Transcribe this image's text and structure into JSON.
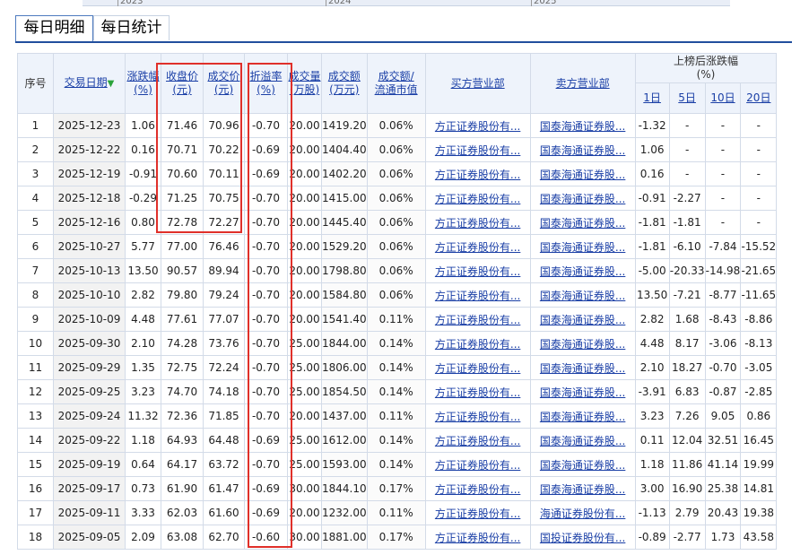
{
  "year_axis": [
    "2023",
    "2024",
    "2025"
  ],
  "tabs": [
    {
      "label": "每日明细",
      "active": true
    },
    {
      "label": "每日统计",
      "active": false
    }
  ],
  "headers": {
    "seq": "序号",
    "date": "交易日期",
    "change": [
      "涨跌幅",
      "(%)"
    ],
    "close": [
      "收盘价",
      "(元)"
    ],
    "deal_price": [
      "成交价",
      "(元)"
    ],
    "premium": [
      "折溢率",
      "(%)"
    ],
    "volume": [
      "成交量",
      "(万股)"
    ],
    "amount": [
      "成交额",
      "(万元)"
    ],
    "ratio": [
      "成交额/",
      "流通市值"
    ],
    "buyer": "买方营业部",
    "seller": "卖方营业部",
    "after": [
      "上榜后涨跌幅",
      "(%)"
    ],
    "after_days": [
      "1日",
      "5日",
      "10日",
      "20日"
    ]
  },
  "rows": [
    {
      "seq": "1",
      "date": "2025-12-23",
      "change": "1.06",
      "close": "71.46",
      "price": "70.96",
      "premium": "-0.70",
      "volume": "20.00",
      "amount": "1419.20",
      "ratio": "0.06%",
      "buyer": "方正证券股份有...",
      "seller": "国泰海通证券股...",
      "d1": "-1.32",
      "d5": "-",
      "d10": "-",
      "d20": "-"
    },
    {
      "seq": "2",
      "date": "2025-12-22",
      "change": "0.16",
      "close": "70.71",
      "price": "70.22",
      "premium": "-0.69",
      "volume": "20.00",
      "amount": "1404.40",
      "ratio": "0.06%",
      "buyer": "方正证券股份有...",
      "seller": "国泰海通证券股...",
      "d1": "1.06",
      "d5": "-",
      "d10": "-",
      "d20": "-"
    },
    {
      "seq": "3",
      "date": "2025-12-19",
      "change": "-0.91",
      "close": "70.60",
      "price": "70.11",
      "premium": "-0.69",
      "volume": "20.00",
      "amount": "1402.20",
      "ratio": "0.06%",
      "buyer": "方正证券股份有...",
      "seller": "国泰海通证券股...",
      "d1": "0.16",
      "d5": "-",
      "d10": "-",
      "d20": "-"
    },
    {
      "seq": "4",
      "date": "2025-12-18",
      "change": "-0.29",
      "close": "71.25",
      "price": "70.75",
      "premium": "-0.70",
      "volume": "20.00",
      "amount": "1415.00",
      "ratio": "0.06%",
      "buyer": "方正证券股份有...",
      "seller": "国泰海通证券股...",
      "d1": "-0.91",
      "d5": "-2.27",
      "d10": "-",
      "d20": "-"
    },
    {
      "seq": "5",
      "date": "2025-12-16",
      "change": "0.80",
      "close": "72.78",
      "price": "72.27",
      "premium": "-0.70",
      "volume": "20.00",
      "amount": "1445.40",
      "ratio": "0.06%",
      "buyer": "方正证券股份有...",
      "seller": "国泰海通证券股...",
      "d1": "-1.81",
      "d5": "-1.81",
      "d10": "-",
      "d20": "-"
    },
    {
      "seq": "6",
      "date": "2025-10-27",
      "change": "5.77",
      "close": "77.00",
      "price": "76.46",
      "premium": "-0.70",
      "volume": "20.00",
      "amount": "1529.20",
      "ratio": "0.06%",
      "buyer": "方正证券股份有...",
      "seller": "国泰海通证券股...",
      "d1": "-1.81",
      "d5": "-6.10",
      "d10": "-7.84",
      "d20": "-15.52"
    },
    {
      "seq": "7",
      "date": "2025-10-13",
      "change": "13.50",
      "close": "90.57",
      "price": "89.94",
      "premium": "-0.70",
      "volume": "20.00",
      "amount": "1798.80",
      "ratio": "0.06%",
      "buyer": "方正证券股份有...",
      "seller": "国泰海通证券股...",
      "d1": "-5.00",
      "d5": "-20.33",
      "d10": "-14.98",
      "d20": "-21.65"
    },
    {
      "seq": "8",
      "date": "2025-10-10",
      "change": "2.82",
      "close": "79.80",
      "price": "79.24",
      "premium": "-0.70",
      "volume": "20.00",
      "amount": "1584.80",
      "ratio": "0.06%",
      "buyer": "方正证券股份有...",
      "seller": "国泰海通证券股...",
      "d1": "13.50",
      "d5": "-7.21",
      "d10": "-8.77",
      "d20": "-11.65"
    },
    {
      "seq": "9",
      "date": "2025-10-09",
      "change": "4.48",
      "close": "77.61",
      "price": "77.07",
      "premium": "-0.70",
      "volume": "20.00",
      "amount": "1541.40",
      "ratio": "0.11%",
      "buyer": "方正证券股份有...",
      "seller": "国泰海通证券股...",
      "d1": "2.82",
      "d5": "1.68",
      "d10": "-8.43",
      "d20": "-8.86"
    },
    {
      "seq": "10",
      "date": "2025-09-30",
      "change": "2.10",
      "close": "74.28",
      "price": "73.76",
      "premium": "-0.70",
      "volume": "25.00",
      "amount": "1844.00",
      "ratio": "0.14%",
      "buyer": "方正证券股份有...",
      "seller": "国泰海通证券股...",
      "d1": "4.48",
      "d5": "8.17",
      "d10": "-3.06",
      "d20": "-8.13"
    },
    {
      "seq": "11",
      "date": "2025-09-29",
      "change": "1.35",
      "close": "72.75",
      "price": "72.24",
      "premium": "-0.70",
      "volume": "25.00",
      "amount": "1806.00",
      "ratio": "0.14%",
      "buyer": "方正证券股份有...",
      "seller": "国泰海通证券股...",
      "d1": "2.10",
      "d5": "18.27",
      "d10": "-0.70",
      "d20": "-3.05"
    },
    {
      "seq": "12",
      "date": "2025-09-25",
      "change": "3.23",
      "close": "74.70",
      "price": "74.18",
      "premium": "-0.70",
      "volume": "25.00",
      "amount": "1854.50",
      "ratio": "0.14%",
      "buyer": "方正证券股份有...",
      "seller": "国泰海通证券股...",
      "d1": "-3.91",
      "d5": "6.83",
      "d10": "-0.87",
      "d20": "-2.85"
    },
    {
      "seq": "13",
      "date": "2025-09-24",
      "change": "11.32",
      "close": "72.36",
      "price": "71.85",
      "premium": "-0.70",
      "volume": "20.00",
      "amount": "1437.00",
      "ratio": "0.11%",
      "buyer": "方正证券股份有...",
      "seller": "国泰海通证券股...",
      "d1": "3.23",
      "d5": "7.26",
      "d10": "9.05",
      "d20": "0.86"
    },
    {
      "seq": "14",
      "date": "2025-09-22",
      "change": "1.18",
      "close": "64.93",
      "price": "64.48",
      "premium": "-0.69",
      "volume": "25.00",
      "amount": "1612.00",
      "ratio": "0.14%",
      "buyer": "方正证券股份有...",
      "seller": "国泰海通证券股...",
      "d1": "0.11",
      "d5": "12.04",
      "d10": "32.51",
      "d20": "16.45"
    },
    {
      "seq": "15",
      "date": "2025-09-19",
      "change": "0.64",
      "close": "64.17",
      "price": "63.72",
      "premium": "-0.70",
      "volume": "25.00",
      "amount": "1593.00",
      "ratio": "0.14%",
      "buyer": "方正证券股份有...",
      "seller": "国泰海通证券股...",
      "d1": "1.18",
      "d5": "11.86",
      "d10": "41.14",
      "d20": "19.99"
    },
    {
      "seq": "16",
      "date": "2025-09-17",
      "change": "0.73",
      "close": "61.90",
      "price": "61.47",
      "premium": "-0.69",
      "volume": "30.00",
      "amount": "1844.10",
      "ratio": "0.17%",
      "buyer": "方正证券股份有...",
      "seller": "国泰海通证券股...",
      "d1": "3.00",
      "d5": "16.90",
      "d10": "25.38",
      "d20": "14.81"
    },
    {
      "seq": "17",
      "date": "2025-09-11",
      "change": "3.33",
      "close": "62.03",
      "price": "61.60",
      "premium": "-0.69",
      "volume": "20.00",
      "amount": "1232.00",
      "ratio": "0.11%",
      "buyer": "方正证券股份有...",
      "seller": "海通证券股份有...",
      "d1": "-1.13",
      "d5": "2.79",
      "d10": "20.43",
      "d20": "19.38"
    },
    {
      "seq": "18",
      "date": "2025-09-05",
      "change": "2.09",
      "close": "63.08",
      "price": "62.70",
      "premium": "-0.60",
      "volume": "30.00",
      "amount": "1881.00",
      "ratio": "0.17%",
      "buyer": "方正证券股份有...",
      "seller": "国投证券股份有...",
      "d1": "-0.89",
      "d5": "-2.77",
      "d10": "1.73",
      "d20": "43.58"
    }
  ]
}
